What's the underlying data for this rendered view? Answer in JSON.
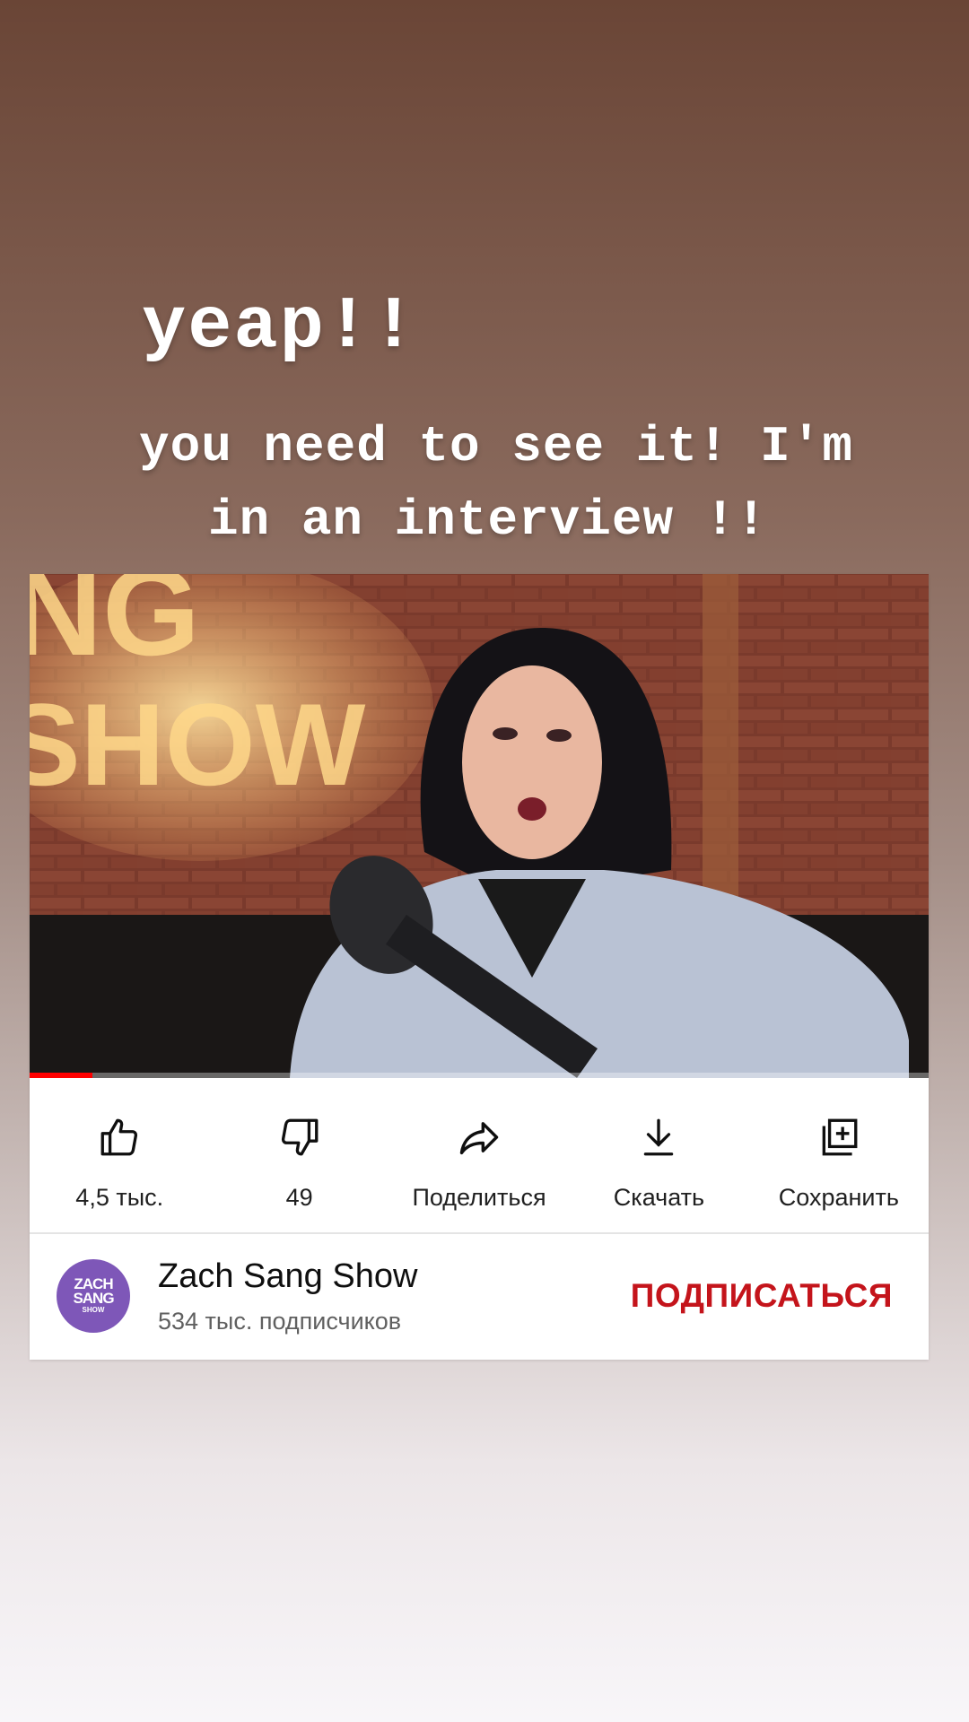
{
  "story": {
    "title": "yeap!!",
    "line1": "you need to see it! I'm",
    "line2": "in an interview !!"
  },
  "video": {
    "watched_fraction": 0.07,
    "background_text": "SHOW"
  },
  "actions": [
    {
      "label": "4,5 тыс.",
      "icon": "thumbs-up-icon"
    },
    {
      "label": "49",
      "icon": "thumbs-down-icon"
    },
    {
      "label": "Поделиться",
      "icon": "share-icon"
    },
    {
      "label": "Скачать",
      "icon": "download-icon"
    },
    {
      "label": "Сохранить",
      "icon": "save-to-playlist-icon"
    }
  ],
  "channel": {
    "name": "Zach Sang Show",
    "subscribers": "534 тыс. подписчиков",
    "avatar_line1": "ZACH",
    "avatar_line2": "SANG",
    "avatar_line3": "SHOW",
    "avatar_color": "#7e57b8"
  },
  "subscribe_label": "ПОДПИСАТЬСЯ",
  "colors": {
    "subscribe": "#c4141b",
    "progress": "#ff0000"
  }
}
